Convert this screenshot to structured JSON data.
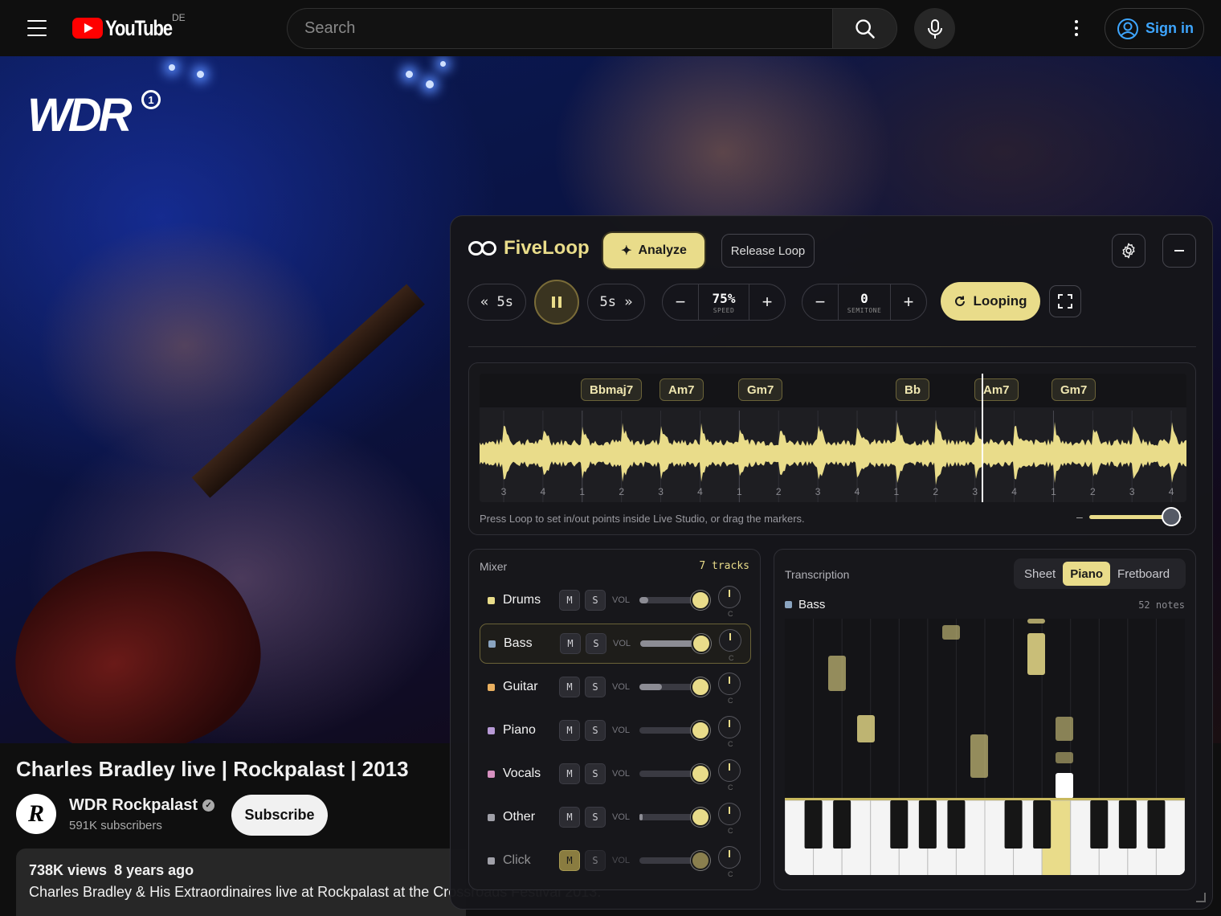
{
  "youtube": {
    "logo_text": "YouTube",
    "region": "DE",
    "search_placeholder": "Search",
    "sign_in": "Sign in"
  },
  "video": {
    "watermark": "WDR",
    "title": "Charles Bradley live | Rockpalast | 2013",
    "channel": {
      "name": "WDR Rockpalast",
      "subscribers": "591K subscribers",
      "avatar_text": "R",
      "verified": true
    },
    "subscribe_label": "Subscribe",
    "views": "738K views",
    "age": "8 years ago",
    "description": "Charles Bradley & His Extraordinaires live at Rockpalast at the Crossroads Festival 2013."
  },
  "fiveloop": {
    "brand": "FiveLoop",
    "analyze_label": "Analyze",
    "release_loop_label": "Release Loop",
    "back_label": "« 5s",
    "forward_label": "5s »",
    "speed": {
      "value": "75%",
      "label": "SPEED"
    },
    "semitone": {
      "value": "0",
      "label": "SEMITONE"
    },
    "looping_label": "Looping",
    "chords": [
      "Bbmaj7",
      "Am7",
      "Gm7",
      "Bb",
      "Am7",
      "Gm7"
    ],
    "beats": [
      "3",
      "4",
      "1",
      "2",
      "3",
      "4",
      "1",
      "2",
      "3",
      "4",
      "1",
      "2",
      "3",
      "4",
      "1",
      "2",
      "3",
      "4"
    ],
    "playhead_fraction": 0.71,
    "hint": "Press Loop to set in/out points inside Live Studio, or drag the markers.",
    "zoom": {
      "minus": "–",
      "plus": "+",
      "level": 0.85
    },
    "mixer": {
      "title": "Mixer",
      "count": "7 tracks",
      "mute_label": "M",
      "solo_label": "S",
      "vol_label": "VOL",
      "pan_label": "C",
      "tracks": [
        {
          "name": "Drums",
          "color": "#e9dc8a",
          "volume": 0.15,
          "selected": false,
          "muted": false
        },
        {
          "name": "Bass",
          "color": "#8aa4c0",
          "volume": 0.95,
          "selected": true,
          "muted": false
        },
        {
          "name": "Guitar",
          "color": "#e9b060",
          "volume": 0.4,
          "selected": false,
          "muted": false
        },
        {
          "name": "Piano",
          "color": "#b89ad6",
          "volume": 0.0,
          "selected": false,
          "muted": false
        },
        {
          "name": "Vocals",
          "color": "#d690c0",
          "volume": 0.0,
          "selected": false,
          "muted": false
        },
        {
          "name": "Other",
          "color": "#a0a0a8",
          "volume": 0.05,
          "selected": false,
          "muted": false
        },
        {
          "name": "Click",
          "color": "#a0a0a8",
          "volume": 0.0,
          "selected": false,
          "muted": true
        }
      ]
    },
    "transcription": {
      "title": "Transcription",
      "tabs": [
        "Sheet",
        "Piano",
        "Fretboard"
      ],
      "active_tab": "Piano",
      "track": "Bass",
      "notes_count": "52 notes"
    }
  }
}
